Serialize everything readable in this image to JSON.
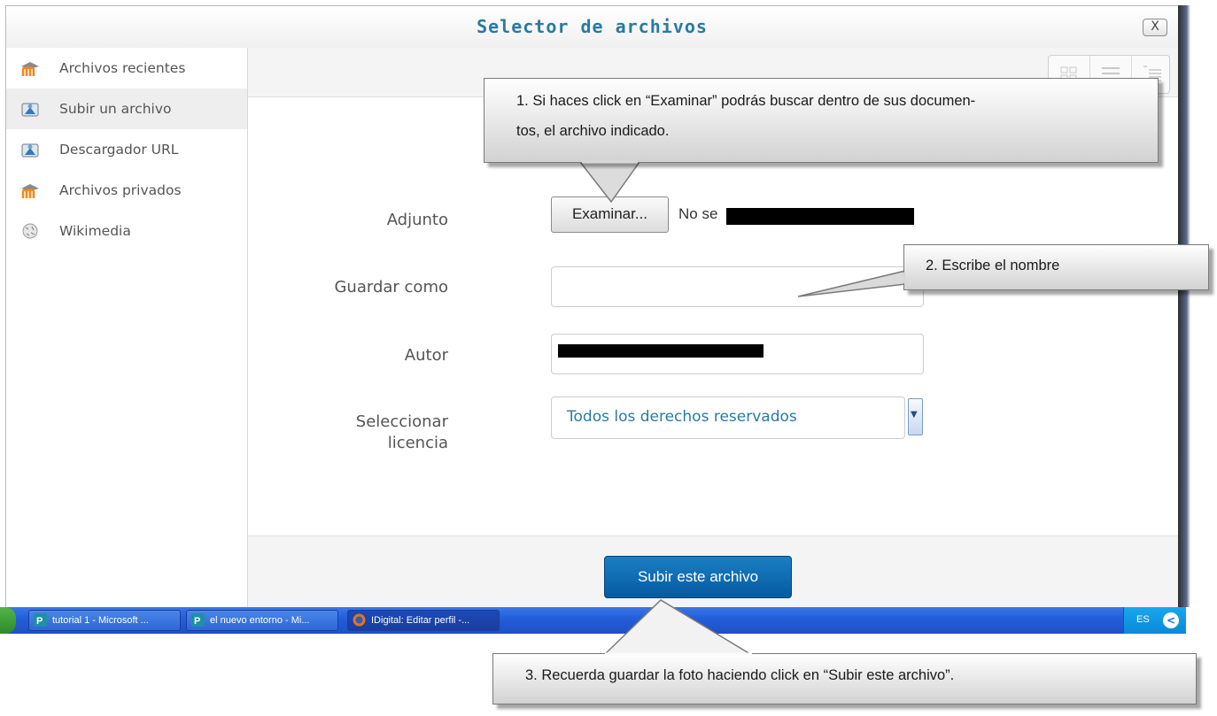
{
  "dialog": {
    "title": "Selector de archivos",
    "close_label": "X"
  },
  "sidebar": {
    "items": [
      {
        "label": "Archivos recientes",
        "icon": "moodle-icon"
      },
      {
        "label": "Subir un archivo",
        "icon": "upload-icon"
      },
      {
        "label": "Descargador URL",
        "icon": "download-url-icon"
      },
      {
        "label": "Archivos privados",
        "icon": "moodle-icon"
      },
      {
        "label": "Wikimedia",
        "icon": "wikimedia-icon"
      }
    ]
  },
  "form": {
    "attachment_label": "Adjunto",
    "browse_button": "Examinar...",
    "no_file_text": "No se",
    "save_as_label": "Guardar como",
    "save_as_value": "",
    "author_label": "Autor",
    "license_label_line1": "Seleccionar",
    "license_label_line2": "licencia",
    "license_value": "Todos los derechos reservados",
    "upload_button": "Subir este archivo"
  },
  "taskbar": {
    "tasks": [
      {
        "label": "tutorial 1 - Microsoft ...",
        "icon": "publisher-icon"
      },
      {
        "label": "el nuevo entorno - Mi...",
        "icon": "publisher-icon"
      },
      {
        "label": "IDigital: Editar perfil -...",
        "icon": "firefox-icon"
      }
    ],
    "language": "ES"
  },
  "callouts": {
    "c1_line1": "1. Si haces click en “Examinar” podrás buscar dentro de sus documen-",
    "c1_line2": "tos, el archivo indicado.",
    "c2": "2.  Escribe el nombre",
    "c3": "3. Recuerda guardar la foto haciendo click en “Subir este archivo”."
  },
  "colors": {
    "title": "#2a7aa0",
    "primary_button": "#0b63ad",
    "link_text": "#2a7aa0",
    "taskbar": "#245edb"
  }
}
